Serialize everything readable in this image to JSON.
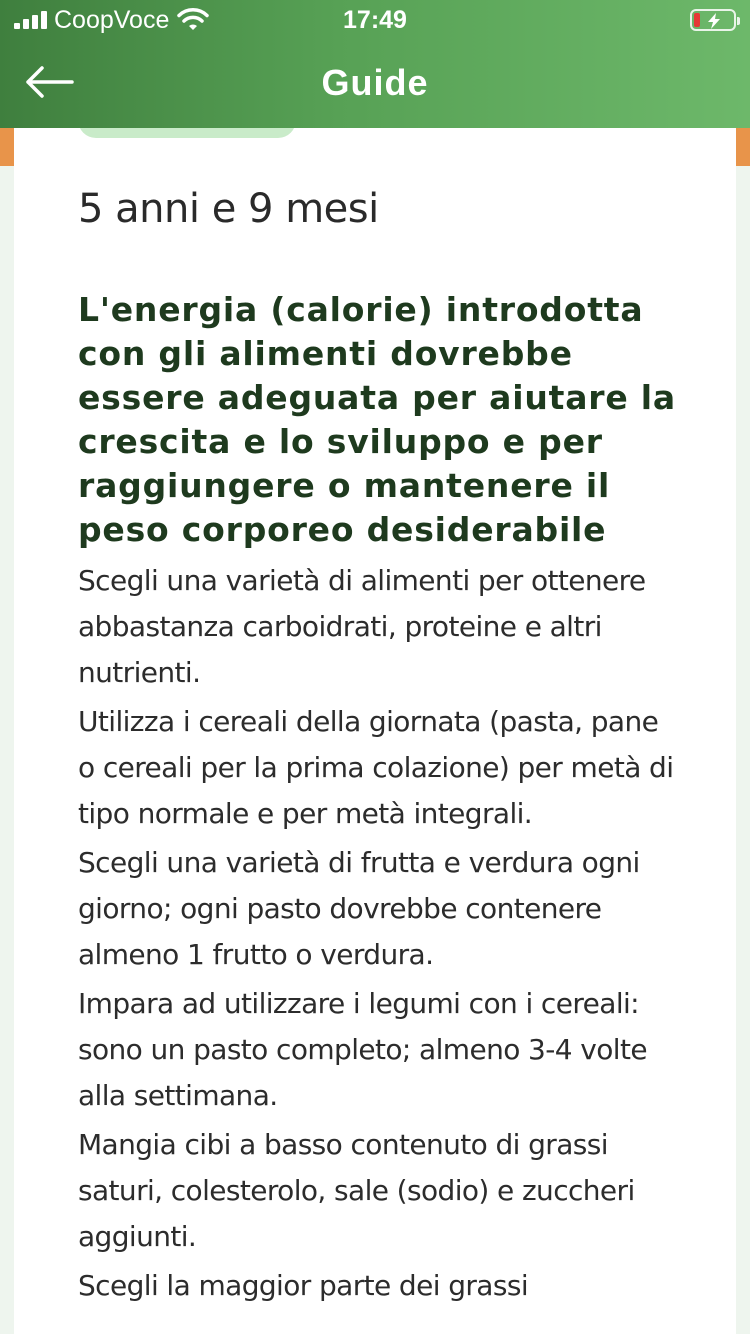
{
  "status_bar": {
    "carrier": "CoopVoce",
    "time": "17:49"
  },
  "header": {
    "title": "Guide",
    "back_icon": "arrow-left-icon"
  },
  "colors": {
    "header_start": "#3f7f3e",
    "header_end": "#6db86a",
    "accent": "#e8944a",
    "heading_text": "#1e3a1e",
    "tab": "#c9ebc9"
  },
  "guide": {
    "age": "5 anni e 9 mesi",
    "heading": "L'energia (calorie) introdotta con gli alimenti dovrebbe essere adeguata per aiutare la crescita e lo sviluppo e per raggiungere o mantenere il peso corporeo desiderabile",
    "paragraphs": [
      "Scegli una varietà di alimenti per ottenere abbastanza carboidrati, proteine e altri nutrienti.",
      "Utilizza i cereali della giornata (pasta, pane o cereali per la prima colazione) per metà di tipo normale e per metà integrali.",
      "Scegli una varietà di frutta e verdura ogni giorno; ogni pasto dovrebbe contenere almeno 1 frutto o verdura.",
      "Impara ad utilizzare i legumi con i cereali: sono un pasto completo; almeno 3-4 volte alla settimana.",
      "Mangia cibi a basso contenuto di grassi saturi, colesterolo, sale (sodio) e zuccheri aggiunti.",
      "Scegli la maggior parte dei grassi"
    ]
  }
}
